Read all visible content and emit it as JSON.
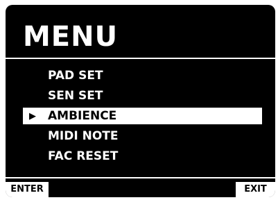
{
  "screen": {
    "title": "MENU",
    "items": [
      {
        "label": "PAD SET",
        "selected": false
      },
      {
        "label": "SEN SET",
        "selected": false
      },
      {
        "label": "AMBIENCE",
        "selected": true
      },
      {
        "label": "MIDI NOTE",
        "selected": false
      },
      {
        "label": "FAC RESET",
        "selected": false
      }
    ],
    "cursor_glyph": "▶",
    "softkeys": {
      "enter_label": "ENTER",
      "exit_label": "EXIT"
    }
  },
  "colors": {
    "background": "#000000",
    "foreground": "#ffffff",
    "highlight": "#ffffff",
    "highlight_text": "#000000"
  }
}
